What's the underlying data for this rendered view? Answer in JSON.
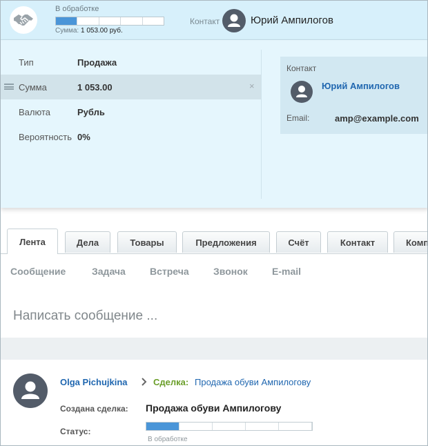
{
  "header": {
    "deal_icon": "handshake-icon",
    "stage_label": "В обработке",
    "stage_progress": 0.2,
    "stage_segments": 5,
    "sum_prefix": "Сумма:",
    "sum_value": "1 053.00 руб.",
    "contact_label": "Контакт",
    "contact_avatar_icon": "user-avatar-icon",
    "contact_name": "Юрий Ампилогов"
  },
  "fields": [
    {
      "label": "Тип",
      "value": "Продажа"
    },
    {
      "label": "Сумма",
      "value": "1 053.00"
    },
    {
      "label": "Валюта",
      "value": "Рубль"
    },
    {
      "label": "Вероятность",
      "value": "0%"
    }
  ],
  "remove_glyph": "×",
  "contact_card": {
    "title": "Контакт",
    "name": "Юрий Ампилогов",
    "email_label": "Email:",
    "email": "amp@example.com"
  },
  "tabs": [
    {
      "label": "Лента",
      "active": true
    },
    {
      "label": "Дела"
    },
    {
      "label": "Товары"
    },
    {
      "label": "Предложения"
    },
    {
      "label": "Счёт"
    },
    {
      "label": "Контакт"
    },
    {
      "label": "Комп"
    }
  ],
  "activity_types": [
    "Сообщение",
    "Задача",
    "Встреча",
    "Звонок",
    "E-mail"
  ],
  "composer_placeholder": "Написать сообщение ...",
  "feed": {
    "author": "Olga Pichujkina",
    "deal_label": "Сделка:",
    "deal_name": "Продажа обуви Ампилогову",
    "created_label": "Создана сделка:",
    "created_value": "Продажа обуви Ампилогову",
    "status_label": "Статус:",
    "status_progress": 0.2,
    "status_segments": 5,
    "status_text": "В обработке"
  },
  "colors": {
    "header_bg": "#d7f0fb",
    "panel_bg": "#e5f6fd",
    "accent_blue": "#2067b0",
    "progress_fill": "#4a95d8",
    "deal_green": "#6a9e29",
    "avatar_grey": "#535c69"
  }
}
